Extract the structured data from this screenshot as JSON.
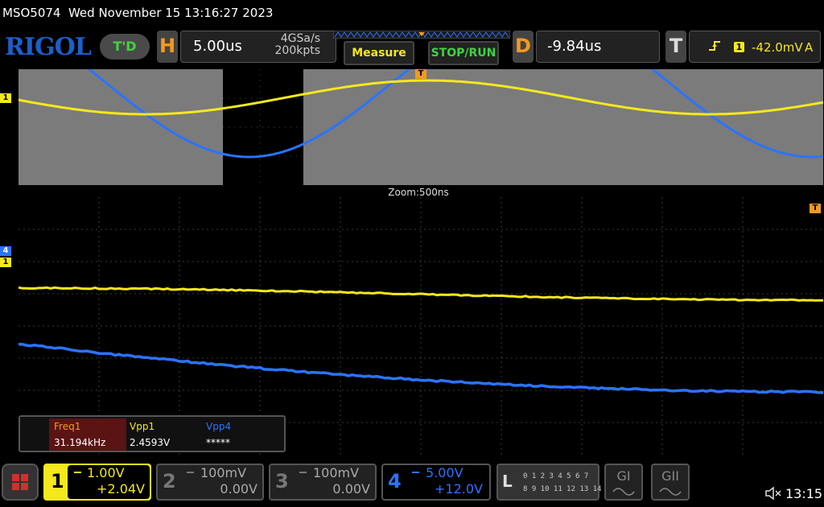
{
  "title": "MSO5074  Wed November 15 13:16:27 2023",
  "toolbar": {
    "logo": "RIGOL",
    "mode_button": "T'D",
    "horizontal": {
      "letter": "H",
      "timebase": "5.00us",
      "sample_rate": "4GSa/s",
      "memory_depth": "200kpts"
    },
    "measure_button": "Measure",
    "stop_run_button": "STOP/RUN",
    "delay": {
      "letter": "D",
      "value": "-9.84us"
    },
    "trigger": {
      "letter": "T",
      "edge_icon": "rising-edge-icon",
      "source": "1",
      "level": "-42.0mV",
      "mode": "A"
    }
  },
  "display": {
    "zoom_label": "Zoom:500ns",
    "trigger_marker": "T",
    "channel_markers": {
      "ch1": "1",
      "ch4": "4"
    }
  },
  "measurements": {
    "headers": [
      "Freq1",
      "Vpp1",
      "Vpp4"
    ],
    "values": [
      "31.194kHz",
      "2.4593V",
      "*****"
    ]
  },
  "channels": [
    {
      "number": "1",
      "scale": "1.00V",
      "offset": "+2.04V",
      "color": "#f5e81c",
      "active": true
    },
    {
      "number": "2",
      "scale": "100mV",
      "offset": "0.00V",
      "color": "#888888",
      "active": false
    },
    {
      "number": "3",
      "scale": "100mV",
      "offset": "0.00V",
      "color": "#888888",
      "active": false
    },
    {
      "number": "4",
      "scale": "5.00V",
      "offset": "+12.0V",
      "color": "#2a74ff",
      "active": true
    }
  ],
  "logic": {
    "letter": "L",
    "row1": "0 1 2 3   4 5 6 7",
    "row2": "8 9 10 11 12 13 14 15"
  },
  "generators": {
    "g1": "GI",
    "g2": "GII"
  },
  "status": {
    "time": "13:15",
    "speaker_icon": "speaker-muted-icon"
  },
  "colors": {
    "ch1": "#f5e81c",
    "ch4": "#2a74ff",
    "accent": "#f39a1e"
  }
}
